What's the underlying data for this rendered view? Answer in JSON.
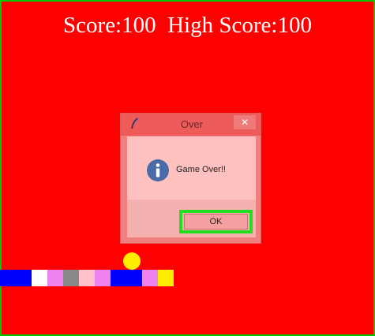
{
  "score": {
    "text": "Score:100  High Score:100"
  },
  "dialog": {
    "title": "Over",
    "close_glyph": "✕",
    "message": "Game Over!!",
    "ok_label": "OK",
    "title_icon": "feather-icon",
    "message_icon": "info-icon"
  },
  "colors": {
    "background": "#ff0000",
    "frame": "#00c800",
    "ball": "#ffee00",
    "highlight": "#22dd22"
  },
  "paddle_bricks": [
    "#0000ff",
    "#0000ff",
    "#ffffff",
    "#ee82ee",
    "#888888",
    "#ffc0cb",
    "#ee82ee",
    "#0000ff",
    "#0000ff",
    "#ee82ee",
    "#ffee00"
  ]
}
